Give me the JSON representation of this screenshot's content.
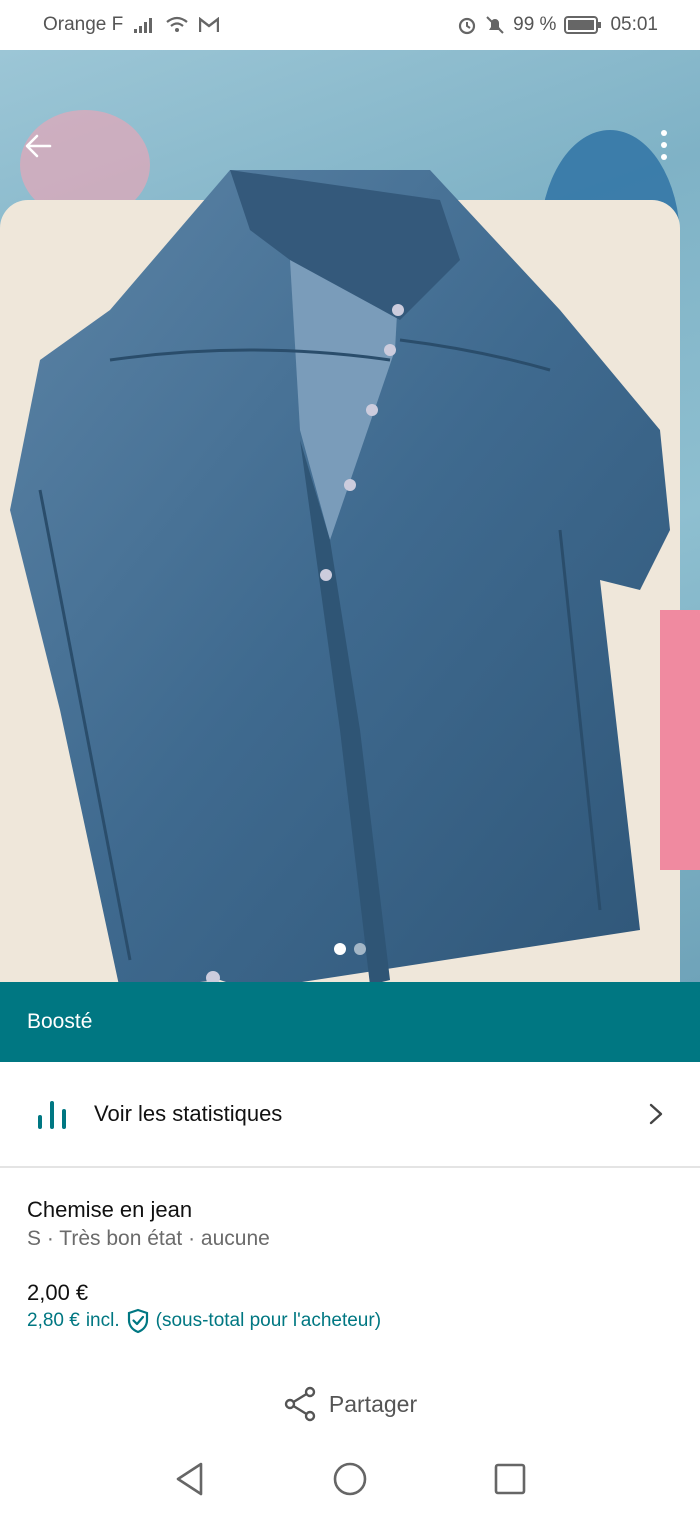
{
  "status_bar": {
    "carrier": "Orange F",
    "battery": "99 %",
    "time": "05:01"
  },
  "photo": {
    "page_count": 2,
    "current_page": 1
  },
  "boost": {
    "label": "Boosté"
  },
  "stats": {
    "label": "Voir les statistiques"
  },
  "item": {
    "title": "Chemise en jean",
    "subtitle": "S · Très bon état · aucune",
    "price": "2,00 €",
    "price_incl": "2,80 €",
    "incl_word": "incl.",
    "buyer_note": "(sous-total pour l'acheteur)"
  },
  "share": {
    "label": "Partager"
  },
  "colors": {
    "accent": "#007782",
    "text_primary": "#111111",
    "text_secondary": "#6b6b6b"
  },
  "icons": [
    "back-arrow-icon",
    "more-vertical-icon",
    "bar-chart-icon",
    "chevron-right-icon",
    "shield-check-icon",
    "share-icon",
    "nav-back-icon",
    "nav-home-icon",
    "nav-recents-icon"
  ]
}
